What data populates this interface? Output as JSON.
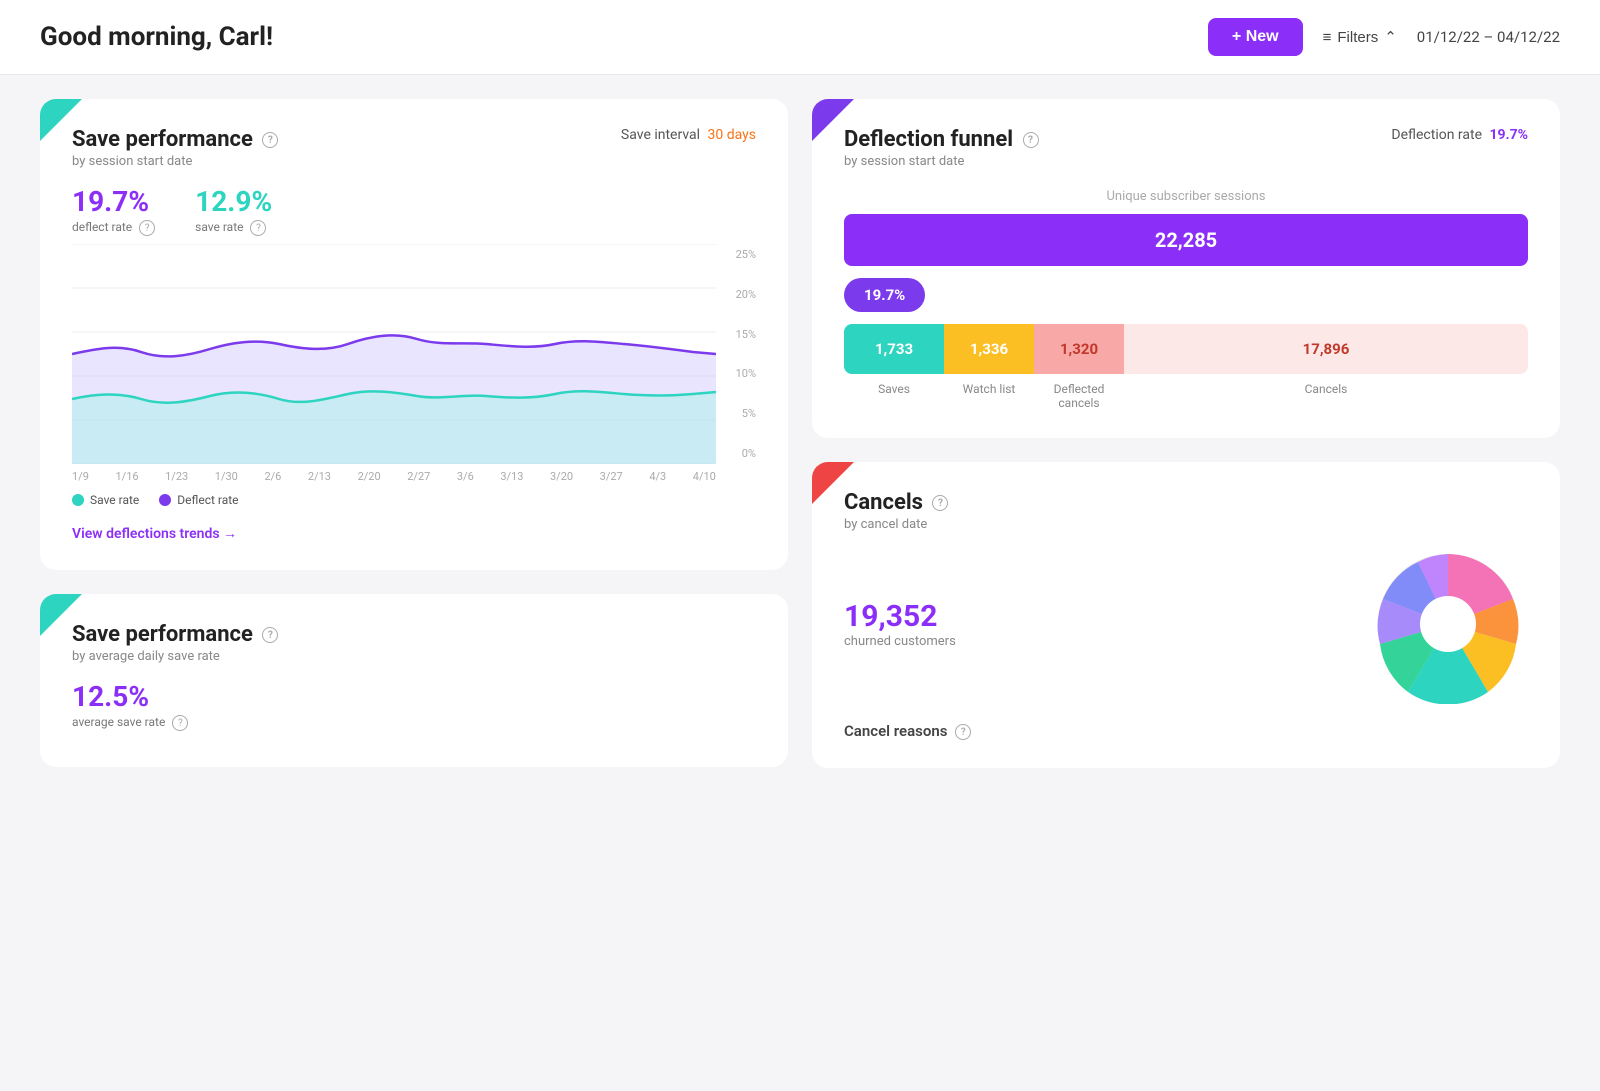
{
  "header": {
    "title": "Good morning, Carl!",
    "new_button": "+ New",
    "filters_label": "Filters",
    "date_range": "01/12/22 – 04/12/22"
  },
  "save_performance_card": {
    "title": "Save performance",
    "subtitle": "by session start date",
    "save_interval_label": "Save interval",
    "save_interval_value": "30 days",
    "deflect_rate_value": "19.7%",
    "deflect_rate_label": "deflect rate",
    "save_rate_value": "12.9%",
    "save_rate_label": "save rate",
    "y_axis": [
      "25%",
      "20%",
      "15%",
      "10%",
      "5%",
      "0%"
    ],
    "x_axis": [
      "1/9",
      "1/16",
      "1/23",
      "1/30",
      "2/6",
      "2/13",
      "2/20",
      "2/27",
      "3/6",
      "3/13",
      "3/20",
      "3/27",
      "4/3",
      "4/10"
    ],
    "legend_save_rate": "Save rate",
    "legend_deflect_rate": "Deflect rate",
    "view_link": "View deflections trends →"
  },
  "save_performance_card2": {
    "title": "Save performance",
    "subtitle": "by average daily save rate",
    "avg_save_rate_value": "12.5%",
    "avg_save_rate_label": "average save rate"
  },
  "deflection_funnel_card": {
    "title": "Deflection funnel",
    "subtitle": "by session start date",
    "deflection_rate_label": "Deflection rate",
    "deflection_rate_value": "19.7%",
    "unique_sessions_label": "Unique subscriber sessions",
    "unique_sessions_value": "22,285",
    "pill_value": "19.7%",
    "saves_value": "1,733",
    "saves_label": "Saves",
    "watchlist_value": "1,336",
    "watchlist_label": "Watch list",
    "deflected_value": "1,320",
    "deflected_label": "Deflected cancels",
    "cancels_value": "17,896",
    "cancels_label": "Cancels"
  },
  "cancels_card": {
    "title": "Cancels",
    "subtitle": "by cancel date",
    "churned_value": "19,352",
    "churned_label": "churned customers",
    "cancel_reasons_label": "Cancel reasons"
  },
  "icons": {
    "info": "?",
    "arrow_right": "→",
    "plus": "+",
    "filter": "≡",
    "chevron": "⌃"
  }
}
